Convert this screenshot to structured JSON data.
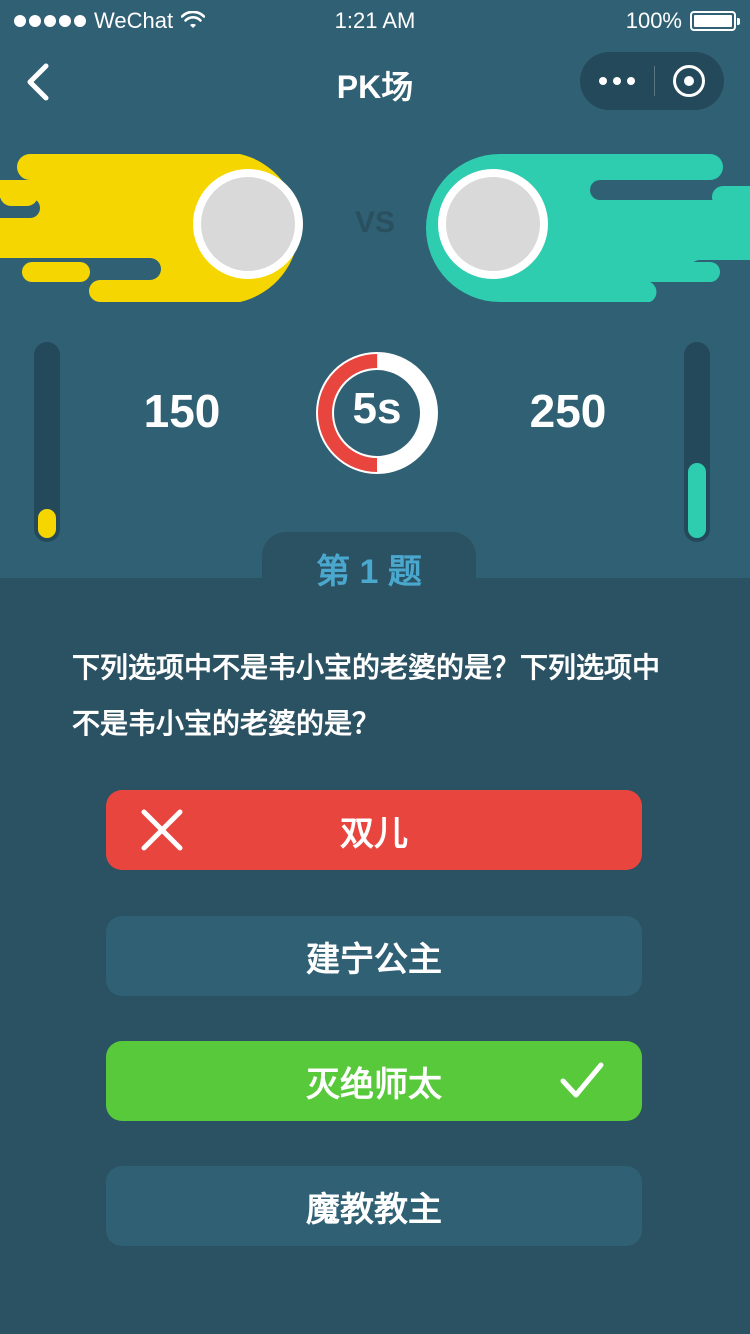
{
  "status_bar": {
    "carrier": "WeChat",
    "time": "1:21 AM",
    "battery": "100%"
  },
  "nav": {
    "title": "PK场"
  },
  "battle": {
    "vs_label": "VS",
    "player1": {
      "score": "150",
      "color": "#f6d600",
      "progress_fraction": 0.15
    },
    "player2": {
      "score": "250",
      "color": "#2ecdb0",
      "progress_fraction": 0.39
    },
    "timer": {
      "text": "5s",
      "remaining_fraction": 0.5,
      "color": "#e8453e"
    }
  },
  "question": {
    "number_label": "第 1 题",
    "text": "下列选项中不是韦小宝的老婆的是？下列选项中不是韦小宝的老婆的是？"
  },
  "options": [
    {
      "label": "双儿",
      "state": "wrong",
      "icon": "close-icon"
    },
    {
      "label": "建宁公主",
      "state": "neutral"
    },
    {
      "label": "灭绝师太",
      "state": "correct",
      "icon": "check-icon"
    },
    {
      "label": "魔教教主",
      "state": "neutral"
    }
  ],
  "colors": {
    "background": "#2b5262",
    "header": "#306074",
    "wrong": "#e8453e",
    "correct": "#57c93b",
    "accent": "#4aa8cf"
  }
}
